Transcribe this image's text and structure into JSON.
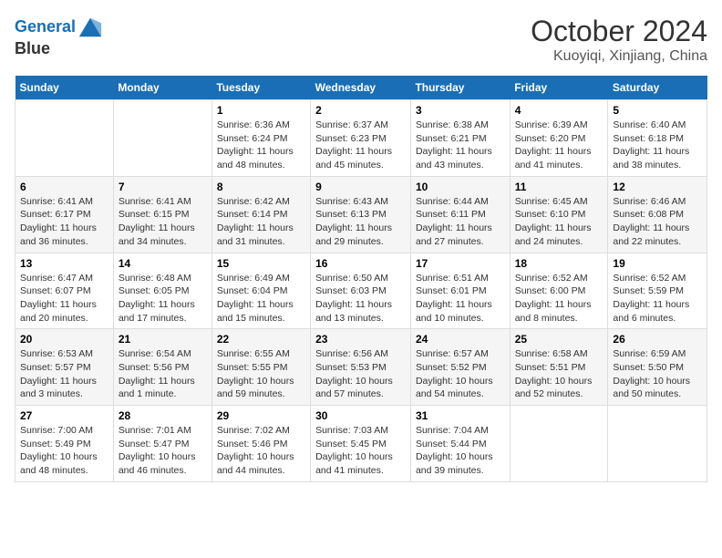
{
  "logo": {
    "line1": "General",
    "line2": "Blue"
  },
  "title": "October 2024",
  "subtitle": "Kuoyiqi, Xinjiang, China",
  "days_of_week": [
    "Sunday",
    "Monday",
    "Tuesday",
    "Wednesday",
    "Thursday",
    "Friday",
    "Saturday"
  ],
  "weeks": [
    [
      {
        "num": "",
        "sunrise": "",
        "sunset": "",
        "daylight": ""
      },
      {
        "num": "",
        "sunrise": "",
        "sunset": "",
        "daylight": ""
      },
      {
        "num": "1",
        "sunrise": "Sunrise: 6:36 AM",
        "sunset": "Sunset: 6:24 PM",
        "daylight": "Daylight: 11 hours and 48 minutes."
      },
      {
        "num": "2",
        "sunrise": "Sunrise: 6:37 AM",
        "sunset": "Sunset: 6:23 PM",
        "daylight": "Daylight: 11 hours and 45 minutes."
      },
      {
        "num": "3",
        "sunrise": "Sunrise: 6:38 AM",
        "sunset": "Sunset: 6:21 PM",
        "daylight": "Daylight: 11 hours and 43 minutes."
      },
      {
        "num": "4",
        "sunrise": "Sunrise: 6:39 AM",
        "sunset": "Sunset: 6:20 PM",
        "daylight": "Daylight: 11 hours and 41 minutes."
      },
      {
        "num": "5",
        "sunrise": "Sunrise: 6:40 AM",
        "sunset": "Sunset: 6:18 PM",
        "daylight": "Daylight: 11 hours and 38 minutes."
      }
    ],
    [
      {
        "num": "6",
        "sunrise": "Sunrise: 6:41 AM",
        "sunset": "Sunset: 6:17 PM",
        "daylight": "Daylight: 11 hours and 36 minutes."
      },
      {
        "num": "7",
        "sunrise": "Sunrise: 6:41 AM",
        "sunset": "Sunset: 6:15 PM",
        "daylight": "Daylight: 11 hours and 34 minutes."
      },
      {
        "num": "8",
        "sunrise": "Sunrise: 6:42 AM",
        "sunset": "Sunset: 6:14 PM",
        "daylight": "Daylight: 11 hours and 31 minutes."
      },
      {
        "num": "9",
        "sunrise": "Sunrise: 6:43 AM",
        "sunset": "Sunset: 6:13 PM",
        "daylight": "Daylight: 11 hours and 29 minutes."
      },
      {
        "num": "10",
        "sunrise": "Sunrise: 6:44 AM",
        "sunset": "Sunset: 6:11 PM",
        "daylight": "Daylight: 11 hours and 27 minutes."
      },
      {
        "num": "11",
        "sunrise": "Sunrise: 6:45 AM",
        "sunset": "Sunset: 6:10 PM",
        "daylight": "Daylight: 11 hours and 24 minutes."
      },
      {
        "num": "12",
        "sunrise": "Sunrise: 6:46 AM",
        "sunset": "Sunset: 6:08 PM",
        "daylight": "Daylight: 11 hours and 22 minutes."
      }
    ],
    [
      {
        "num": "13",
        "sunrise": "Sunrise: 6:47 AM",
        "sunset": "Sunset: 6:07 PM",
        "daylight": "Daylight: 11 hours and 20 minutes."
      },
      {
        "num": "14",
        "sunrise": "Sunrise: 6:48 AM",
        "sunset": "Sunset: 6:05 PM",
        "daylight": "Daylight: 11 hours and 17 minutes."
      },
      {
        "num": "15",
        "sunrise": "Sunrise: 6:49 AM",
        "sunset": "Sunset: 6:04 PM",
        "daylight": "Daylight: 11 hours and 15 minutes."
      },
      {
        "num": "16",
        "sunrise": "Sunrise: 6:50 AM",
        "sunset": "Sunset: 6:03 PM",
        "daylight": "Daylight: 11 hours and 13 minutes."
      },
      {
        "num": "17",
        "sunrise": "Sunrise: 6:51 AM",
        "sunset": "Sunset: 6:01 PM",
        "daylight": "Daylight: 11 hours and 10 minutes."
      },
      {
        "num": "18",
        "sunrise": "Sunrise: 6:52 AM",
        "sunset": "Sunset: 6:00 PM",
        "daylight": "Daylight: 11 hours and 8 minutes."
      },
      {
        "num": "19",
        "sunrise": "Sunrise: 6:52 AM",
        "sunset": "Sunset: 5:59 PM",
        "daylight": "Daylight: 11 hours and 6 minutes."
      }
    ],
    [
      {
        "num": "20",
        "sunrise": "Sunrise: 6:53 AM",
        "sunset": "Sunset: 5:57 PM",
        "daylight": "Daylight: 11 hours and 3 minutes."
      },
      {
        "num": "21",
        "sunrise": "Sunrise: 6:54 AM",
        "sunset": "Sunset: 5:56 PM",
        "daylight": "Daylight: 11 hours and 1 minute."
      },
      {
        "num": "22",
        "sunrise": "Sunrise: 6:55 AM",
        "sunset": "Sunset: 5:55 PM",
        "daylight": "Daylight: 10 hours and 59 minutes."
      },
      {
        "num": "23",
        "sunrise": "Sunrise: 6:56 AM",
        "sunset": "Sunset: 5:53 PM",
        "daylight": "Daylight: 10 hours and 57 minutes."
      },
      {
        "num": "24",
        "sunrise": "Sunrise: 6:57 AM",
        "sunset": "Sunset: 5:52 PM",
        "daylight": "Daylight: 10 hours and 54 minutes."
      },
      {
        "num": "25",
        "sunrise": "Sunrise: 6:58 AM",
        "sunset": "Sunset: 5:51 PM",
        "daylight": "Daylight: 10 hours and 52 minutes."
      },
      {
        "num": "26",
        "sunrise": "Sunrise: 6:59 AM",
        "sunset": "Sunset: 5:50 PM",
        "daylight": "Daylight: 10 hours and 50 minutes."
      }
    ],
    [
      {
        "num": "27",
        "sunrise": "Sunrise: 7:00 AM",
        "sunset": "Sunset: 5:49 PM",
        "daylight": "Daylight: 10 hours and 48 minutes."
      },
      {
        "num": "28",
        "sunrise": "Sunrise: 7:01 AM",
        "sunset": "Sunset: 5:47 PM",
        "daylight": "Daylight: 10 hours and 46 minutes."
      },
      {
        "num": "29",
        "sunrise": "Sunrise: 7:02 AM",
        "sunset": "Sunset: 5:46 PM",
        "daylight": "Daylight: 10 hours and 44 minutes."
      },
      {
        "num": "30",
        "sunrise": "Sunrise: 7:03 AM",
        "sunset": "Sunset: 5:45 PM",
        "daylight": "Daylight: 10 hours and 41 minutes."
      },
      {
        "num": "31",
        "sunrise": "Sunrise: 7:04 AM",
        "sunset": "Sunset: 5:44 PM",
        "daylight": "Daylight: 10 hours and 39 minutes."
      },
      {
        "num": "",
        "sunrise": "",
        "sunset": "",
        "daylight": ""
      },
      {
        "num": "",
        "sunrise": "",
        "sunset": "",
        "daylight": ""
      }
    ]
  ]
}
